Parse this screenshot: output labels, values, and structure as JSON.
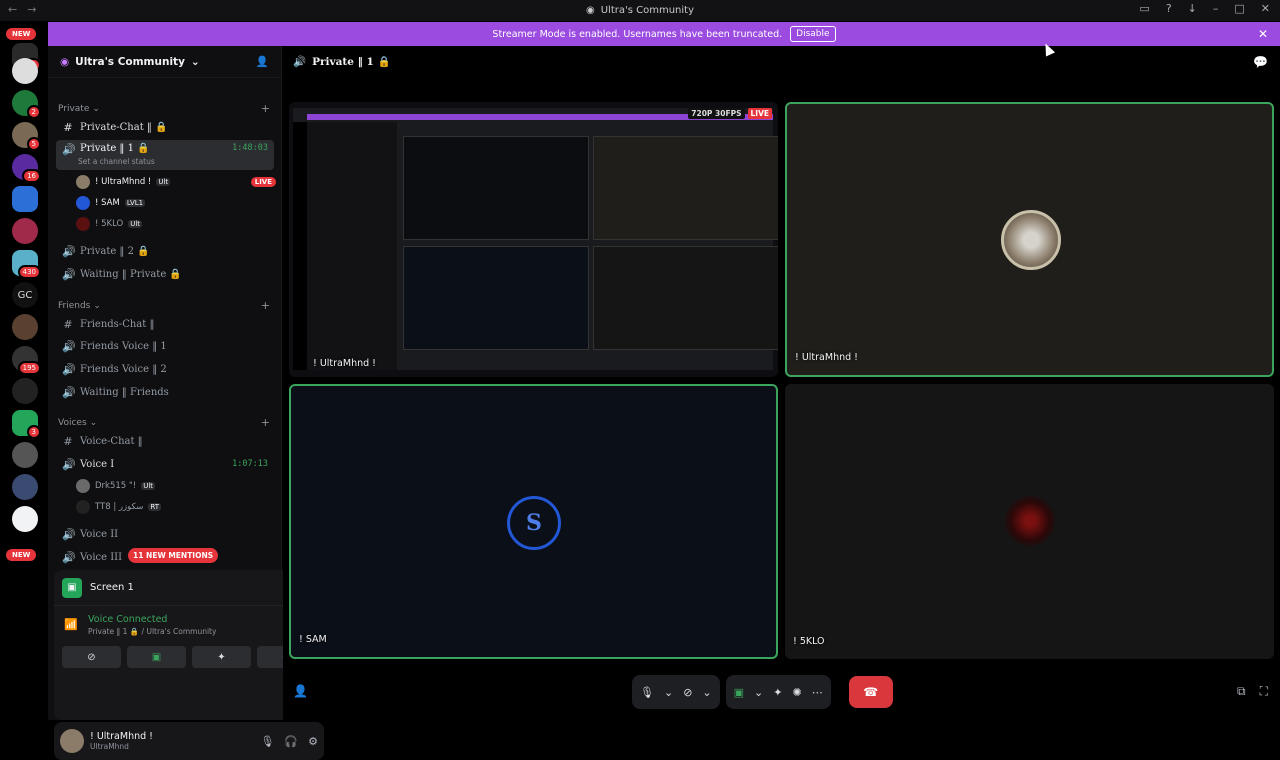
{
  "window": {
    "title": "Ultra's Community"
  },
  "banner": {
    "text": "Streamer Mode is enabled. Usernames have been truncated.",
    "button": "Disable"
  },
  "rail": {
    "new_top": "NEW",
    "new_bottom": "NEW",
    "badges": [
      "96",
      "2",
      "5",
      "16",
      "430",
      "195",
      "3"
    ],
    "gc_label": "GC"
  },
  "server": {
    "name": "Ultra's Community"
  },
  "categories": {
    "private": "Private",
    "friends": "Friends",
    "voices": "Voices"
  },
  "channels": {
    "private_chat": "Private-Chat ‖ 🔒",
    "private_1": "Private ‖ 1 🔒",
    "private_1_time": "1:48:03",
    "private_1_status": "Set a channel status",
    "private_2": "Private ‖ 2 🔒",
    "waiting_private": "Waiting ‖ Private 🔒",
    "friends_chat": "Friends-Chat ‖",
    "friends_voice_1": "Friends Voice ‖ 1",
    "friends_voice_2": "Friends Voice ‖ 2",
    "waiting_friends": "Waiting ‖ Friends",
    "voice_chat": "Voice-Chat ‖",
    "voice_1": "Voice I",
    "voice_1_time": "1:07:13",
    "voice_2": "Voice II",
    "voice_3": "Voice III"
  },
  "users_private": [
    {
      "name": "! UltraMhnd !",
      "tag": "Ult",
      "live": "LIVE"
    },
    {
      "name": "! SAM",
      "tag": "LVL1"
    },
    {
      "name": "! 5KLO",
      "tag": "Ult"
    }
  ],
  "users_voice": [
    {
      "name": "Drk515 \"!",
      "tag": "Ult"
    },
    {
      "name": "TT8 | سكوزر",
      "tag": "RT"
    }
  ],
  "mentions": "11 NEW MENTIONS",
  "panel": {
    "screen_title": "Screen 1",
    "voice_status": "Voice Connected",
    "voice_channel": "Private ‖ 1 🔒 / Ultra's Community"
  },
  "userbar": {
    "name": "! UltraMhnd !",
    "status": "UltraMhnd"
  },
  "main": {
    "channel_title": "Private ‖ 1 🔒",
    "stream_quality": "720P 30FPS",
    "stream_live": "LIVE",
    "tiles": {
      "t1": "! UltraMhnd !",
      "t2": "! UltraMhnd !",
      "t3": "! SAM",
      "t4": "! 5KLO"
    }
  }
}
